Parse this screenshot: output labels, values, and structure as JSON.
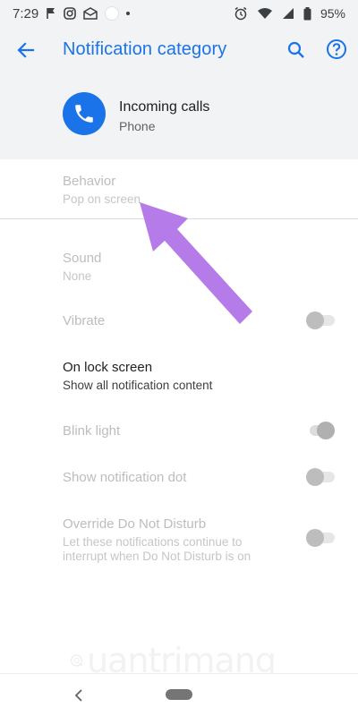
{
  "status_bar": {
    "time": "7:29",
    "battery": "95%"
  },
  "toolbar": {
    "title": "Notification category"
  },
  "app": {
    "name": "Incoming calls",
    "source": "Phone"
  },
  "settings": {
    "behavior": {
      "title": "Behavior",
      "value": "Pop on screen"
    },
    "sound": {
      "title": "Sound",
      "value": "None"
    },
    "vibrate": {
      "title": "Vibrate",
      "enabled": false
    },
    "lock_screen": {
      "title": "On lock screen",
      "value": "Show all notification content"
    },
    "blink_light": {
      "title": "Blink light",
      "enabled": true
    },
    "notification_dot": {
      "title": "Show notification dot",
      "enabled": false
    },
    "dnd": {
      "title": "Override Do Not Disturb",
      "line1": "Let these notifications continue to",
      "line2": "interrupt when Do Not Disturb is on",
      "enabled": false
    }
  },
  "colors": {
    "accent": "#1a73e8",
    "arrow": "#b57be8"
  },
  "watermark": {
    "text": "uantrimang"
  }
}
